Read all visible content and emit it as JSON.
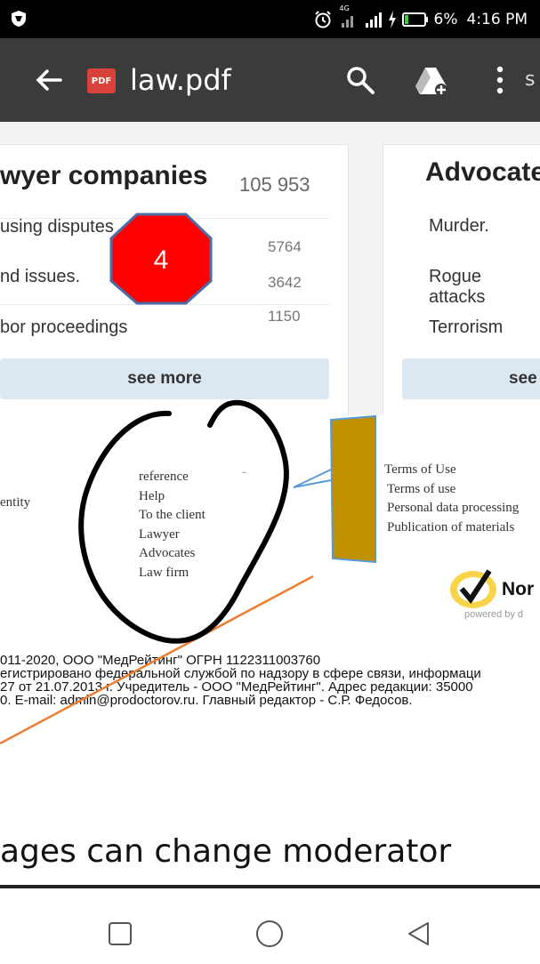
{
  "status_bar": {
    "network": "4G",
    "battery": "6%",
    "time": "4:16 PM"
  },
  "toolbar": {
    "file_badge": "PDF",
    "title": "law.pdf",
    "clipped_text": "s"
  },
  "document": {
    "card_left": {
      "heading": "wyer companies",
      "count": "105 953",
      "rows": [
        {
          "label": "using disputes",
          "value": "5764"
        },
        {
          "label": "nd issues.",
          "value": "3642"
        },
        {
          "label": "bor proceedings",
          "value": "1150"
        }
      ],
      "see_more": "see more"
    },
    "card_right": {
      "heading": "Advocate",
      "rows": [
        "Murder.",
        "Rogue attacks",
        "Terrorism"
      ],
      "see_more": "see"
    },
    "footer": {
      "left_fragment": "entity",
      "center_links": [
        "reference",
        "Help",
        "To the client",
        "Lawyer",
        "Advocates",
        "Law firm"
      ],
      "dash": "-",
      "right_links": [
        "Terms of Use",
        "Terms of use",
        "Personal data processing",
        "Publication of materials"
      ],
      "norton_text": "Nor",
      "norton_powered": "powered by d"
    },
    "legal_lines": [
      "011-2020, ООО \"МедРейтинг\" ОГРН 1122311003760",
      "егистрировано федеральной службой по надзору в сфере связи, информаци",
      "27 от 21.07.2013 г. Учредитель - ООО \"МедРейтинг\". Адрес редакции: 35000",
      "0. E-mail: admin@prodoctorov.ru. Главный редактор - С.Р. Федосов."
    ]
  },
  "annotation": {
    "stop_number": "4"
  },
  "caption": "ages can change moderator",
  "colors": {
    "toolbar_bg": "#3b3b3b",
    "stop_sign": "#ff0000",
    "callout_fill": "#bf9000",
    "callout_stroke": "#5b9bd5",
    "orange_line": "#ed7d31",
    "see_more_bg": "#dbe7f1",
    "pdf_badge": "#d9423a"
  }
}
